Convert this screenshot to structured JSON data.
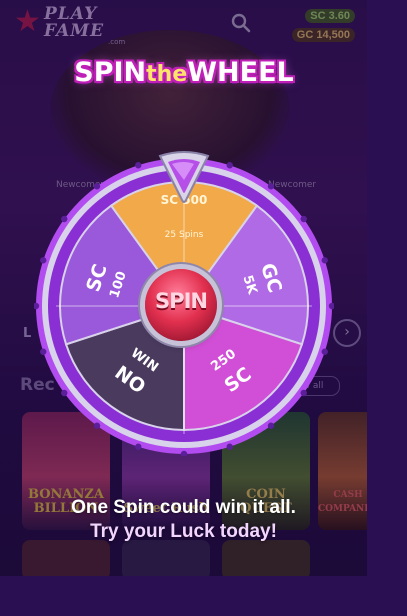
{
  "app": {
    "logo_line1": "PLAY",
    "logo_line2": "FAME",
    "logo_suffix": ".com",
    "balance_sc": "SC 3.60",
    "balance_gc": "GC 14,500",
    "newcomer_left": "Newcomer",
    "newcomer_right": "Newcomer",
    "tab_label": "L",
    "section_title": "Rec",
    "view_all": "w all",
    "games": [
      {
        "name": "BONANZA BILLION"
      },
      {
        "name": "Sweet Rush"
      },
      {
        "name": "COIN QUEST"
      },
      {
        "name": "CASH COMPANIONS"
      }
    ]
  },
  "modal": {
    "title_spin": "SPIN",
    "title_the": "the",
    "title_wheel": "WHEEL",
    "hub_label": "SPIN",
    "segments": [
      {
        "line1": "SC 500",
        "line2": "25 Spins",
        "color": "#f2a94a"
      },
      {
        "line1": "GC",
        "line2": "5K",
        "color": "#b06ae6"
      },
      {
        "line1": "SC",
        "line2": "250",
        "color": "#d14ed6"
      },
      {
        "line1": "NO",
        "line2": "WIN",
        "color": "#4a3a5e"
      },
      {
        "line1": "SC",
        "line2": "100",
        "color": "#9a58db"
      }
    ],
    "caption_line1": "One Spin could win it all.",
    "caption_line2": "Try your Luck today!"
  },
  "colors": {
    "rim": "#8a2fd4",
    "rim_outer": "#b34cf0",
    "accent": "#ffd24a"
  }
}
